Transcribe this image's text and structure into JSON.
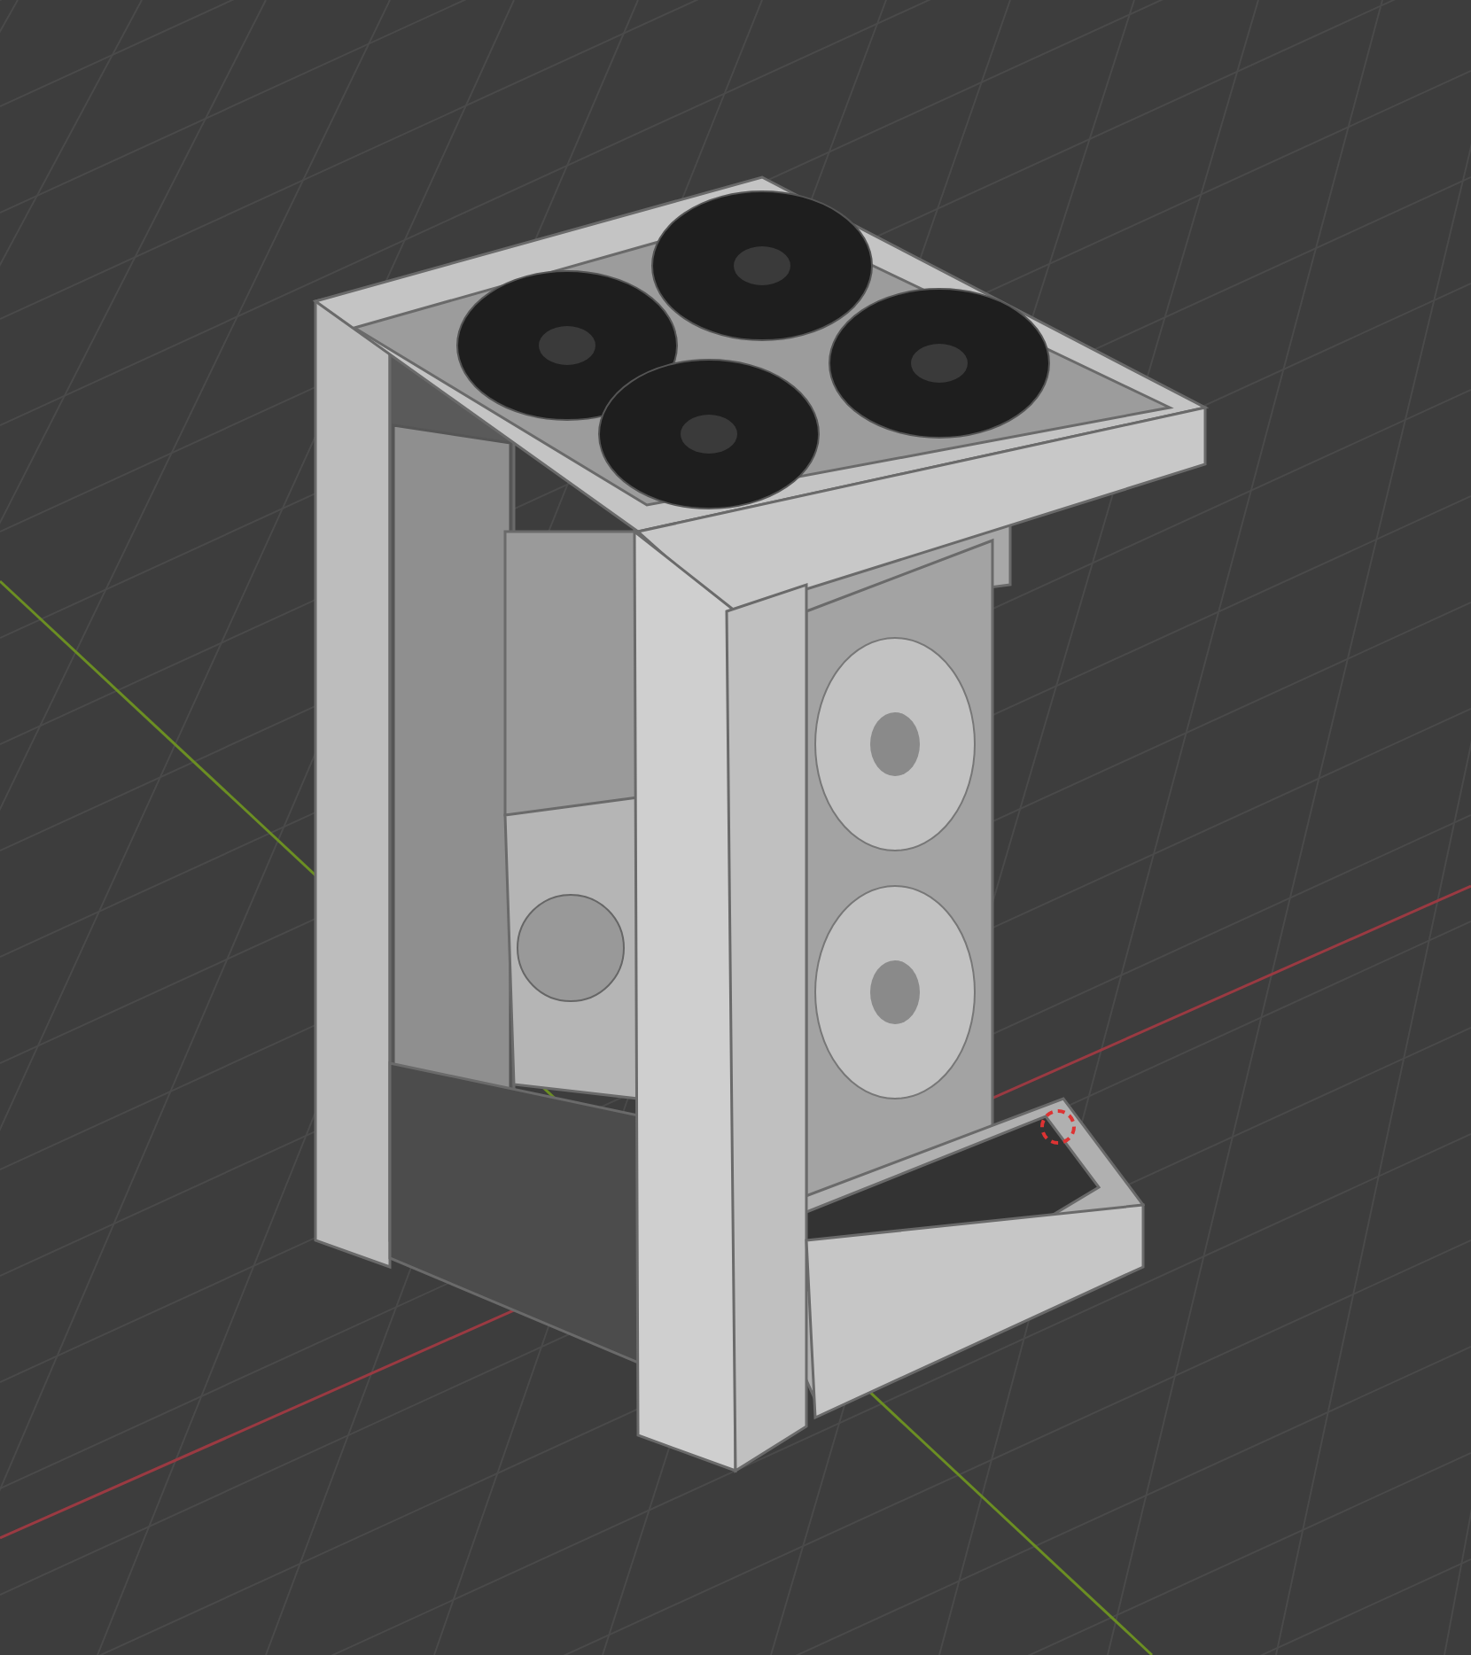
{
  "viewport": {
    "axes": [
      {
        "kind": "x",
        "color": "#9a3a42"
      },
      {
        "kind": "y",
        "color": "#6b8e23"
      }
    ],
    "cursor_visible": true
  }
}
